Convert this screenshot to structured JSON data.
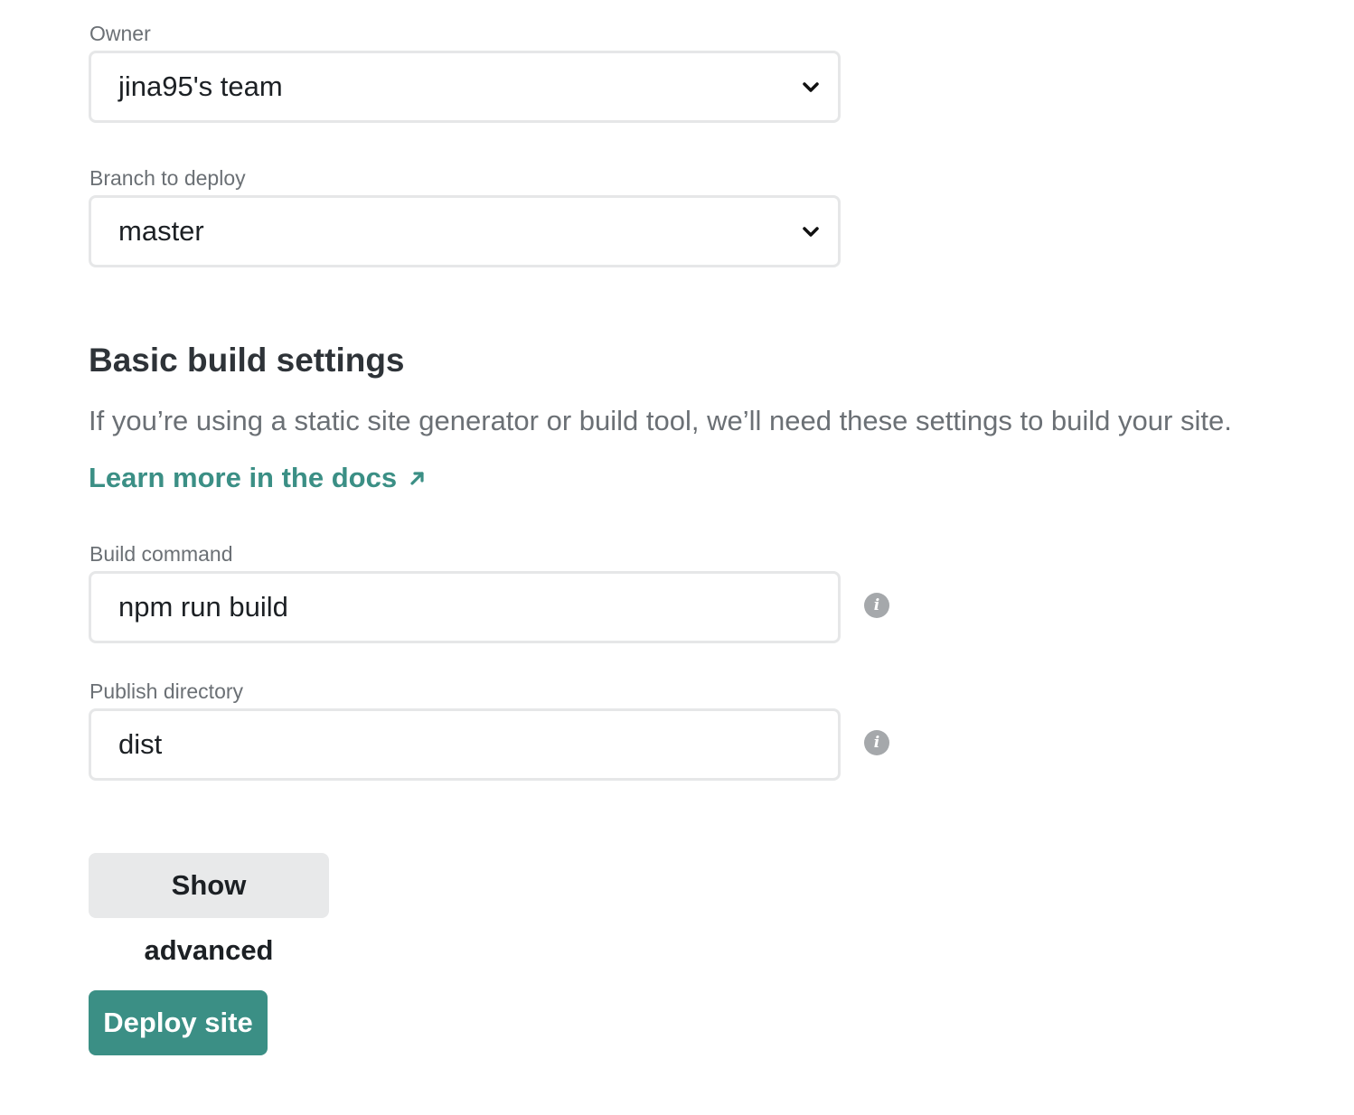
{
  "owner": {
    "label": "Owner",
    "selected": "jina95's team"
  },
  "branch": {
    "label": "Branch to deploy",
    "selected": "master"
  },
  "build_settings": {
    "title": "Basic build settings",
    "description": "If you’re using a static site generator or build tool, we’ll need these settings to build your site.",
    "docs_link": "Learn more in the docs"
  },
  "build_command": {
    "label": "Build command",
    "value": "npm run build"
  },
  "publish_directory": {
    "label": "Publish directory",
    "value": "dist"
  },
  "buttons": {
    "show_advanced": "Show advanced",
    "deploy": "Deploy site"
  },
  "icons": {
    "select_chevron": "chevron-down-icon",
    "info": "info-icon",
    "external_link": "external-link-arrow-icon"
  },
  "colors": {
    "accent": "#3b8f85",
    "label_text": "#6b7075",
    "body_text": "#2e3338",
    "border": "#e6e7e8",
    "secondary_button": "#e8e9ea",
    "info_icon": "#a5a8ab"
  }
}
